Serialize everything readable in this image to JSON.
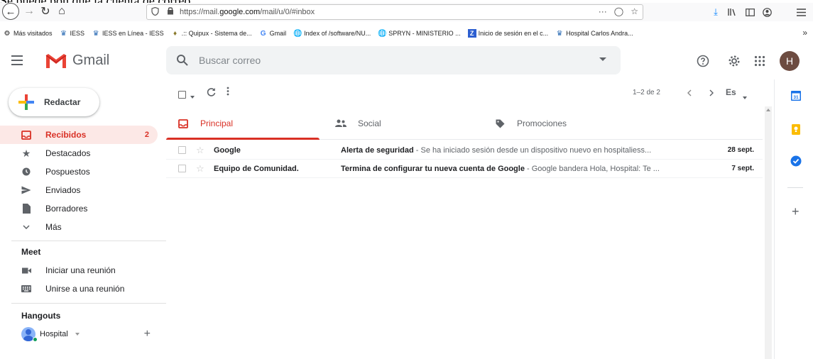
{
  "page_top_text": "Se puede pon que la cuenta de correo",
  "browser": {
    "url_prefix": "https://mail.",
    "url_domain": "google.com",
    "url_suffix": "/mail/u/0/#inbox",
    "url_actions": "···",
    "bookmarks": [
      {
        "icon": "star-icon",
        "label": "Más visitados"
      },
      {
        "icon": "iess-icon",
        "label": "IESS"
      },
      {
        "icon": "iess-icon",
        "label": "IESS en Línea - IESS"
      },
      {
        "icon": "quipux-icon",
        "label": ".:: Quipux - Sistema de..."
      },
      {
        "icon": "google-icon",
        "label": "Gmail"
      },
      {
        "icon": "globe-icon",
        "label": "Index of /software/NU..."
      },
      {
        "icon": "globe-icon",
        "label": "SPRYN - MINISTERIO ..."
      },
      {
        "icon": "z-icon",
        "label": "Inicio de sesión en el c..."
      },
      {
        "icon": "hospital-icon",
        "label": "Hospital Carlos Andra..."
      }
    ]
  },
  "gmail": {
    "logo_text": "Gmail",
    "search_placeholder": "Buscar correo",
    "avatar_letter": "H",
    "compose_label": "Redactar",
    "nav": [
      {
        "id": "inbox",
        "label": "Recibidos",
        "count": "2",
        "icon": "inbox-icon",
        "active": true
      },
      {
        "id": "starred",
        "label": "Destacados",
        "count": "",
        "icon": "star-icon",
        "active": false
      },
      {
        "id": "snoozed",
        "label": "Pospuestos",
        "count": "",
        "icon": "clock-icon",
        "active": false
      },
      {
        "id": "sent",
        "label": "Enviados",
        "count": "",
        "icon": "send-icon",
        "active": false
      },
      {
        "id": "drafts",
        "label": "Borradores",
        "count": "",
        "icon": "draft-icon",
        "active": false
      },
      {
        "id": "more",
        "label": "Más",
        "count": "",
        "icon": "chevron-down-icon",
        "active": false
      }
    ],
    "meet": {
      "title": "Meet",
      "start": "Iniciar una reunión",
      "join": "Unirse a una reunión"
    },
    "hangouts": {
      "title": "Hangouts",
      "user": "Hospital"
    },
    "toolbar": {
      "pager": "1–2 de 2",
      "lang": "Es"
    },
    "tabs": [
      {
        "label": "Principal",
        "icon": "inbox-icon",
        "active": true
      },
      {
        "label": "Social",
        "icon": "people-icon",
        "active": false
      },
      {
        "label": "Promociones",
        "icon": "tag-icon",
        "active": false
      }
    ],
    "emails": [
      {
        "sender": "Google",
        "subject": "Alerta de seguridad",
        "snippet": " - Se ha iniciado sesión desde un dispositivo nuevo en hospitaliess...",
        "date": "28 sept."
      },
      {
        "sender": "Equipo de Comunidad.",
        "subject": "Termina de configurar tu nueva cuenta de Google",
        "snippet": " - Google bandera Hola, Hospital: Te ...",
        "date": "7 sept."
      }
    ]
  },
  "colors": {
    "accent_red": "#d93025",
    "active_bg": "#fce8e6",
    "avatar_bg": "#6d4c41",
    "tasks_blue": "#1a73e8",
    "keep_yellow": "#fbbc04"
  }
}
